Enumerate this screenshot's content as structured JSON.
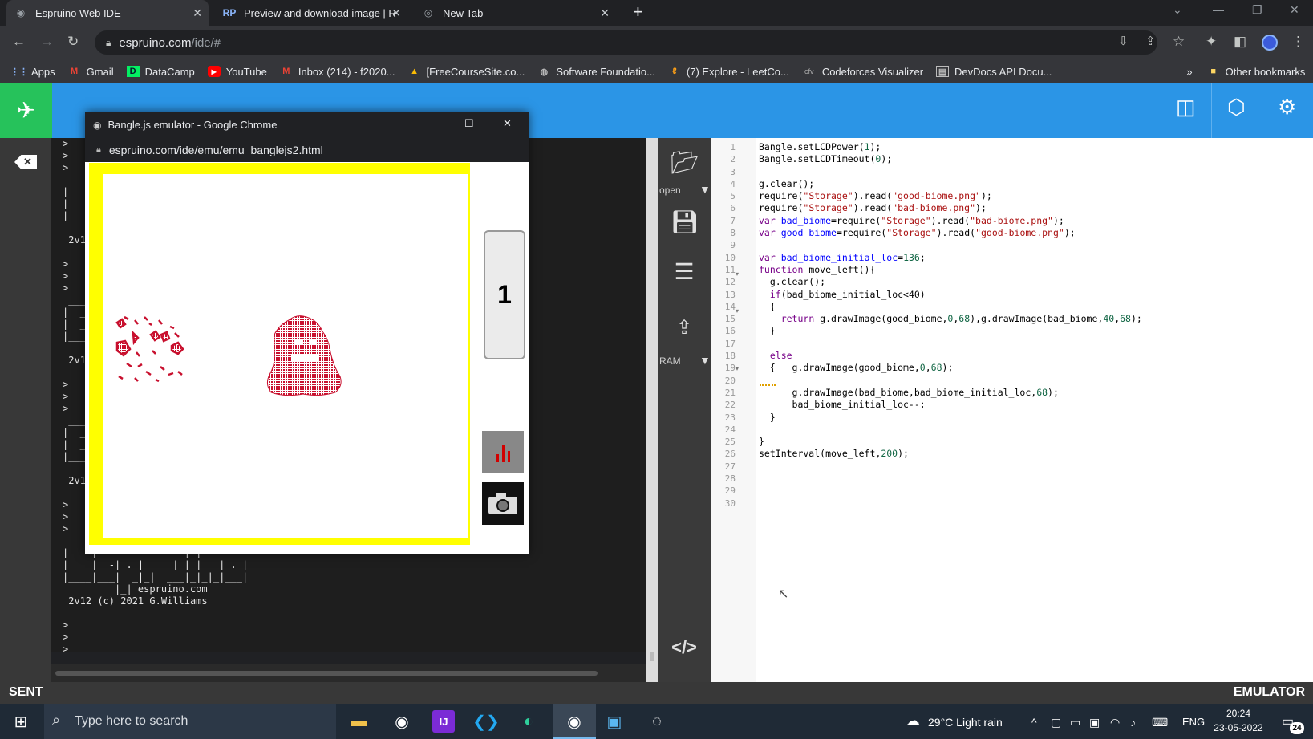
{
  "browser": {
    "tabs": [
      {
        "label": "Espruino Web IDE"
      },
      {
        "label": "Preview and download image | R"
      },
      {
        "label": "New Tab"
      }
    ],
    "url_host": "espruino.com",
    "url_path": "/ide/#",
    "bookmarks": [
      {
        "label": "Apps",
        "icon": "apps-grid-icon"
      },
      {
        "label": "Gmail",
        "icon": "gmail-icon"
      },
      {
        "label": "DataCamp",
        "icon": "datacamp-icon"
      },
      {
        "label": "YouTube",
        "icon": "youtube-icon"
      },
      {
        "label": "Inbox (214) - f2020...",
        "icon": "gmail-icon"
      },
      {
        "label": "[FreeCourseSite.co...",
        "icon": "drive-icon"
      },
      {
        "label": "Software Foundatio...",
        "icon": "globe-icon"
      },
      {
        "label": "(7) Explore - LeetCo...",
        "icon": "leetcode-icon"
      },
      {
        "label": "Codeforces Visualizer",
        "icon": "cfv-icon"
      },
      {
        "label": "DevDocs API Docu...",
        "icon": "devdocs-icon"
      }
    ],
    "more_bookmarks": "»",
    "other_bookmarks": "Other bookmarks"
  },
  "emulator": {
    "window_title": "Bangle.js emulator - Google Chrome",
    "url": "espruino.com/ide/emu/emu_banglejs2.html",
    "button_label": "1"
  },
  "terminal": {
    "lines": [
      ">",
      ">",
      ">",
      " ____                 _",
      "|  __|___ ___ ___ _ _|_|___ ___",
      "|  __|_ -| . |  _| | | |   | . |",
      "|____|___|  _|_| |___|_|_|_|___|",
      "         |_| espruino.com",
      " 2v1",
      "",
      ">",
      ">",
      ">",
      " ____",
      "|  __",
      "|  __",
      "|____",
      "",
      " 2v1",
      "",
      ">",
      ">",
      ">",
      " ____",
      "|  __",
      "|  __",
      "|____",
      "",
      " 2v1",
      "",
      ">",
      ">",
      ">",
      " ____                 _",
      "|  __|___ ___ ___ _ _|_|___ ___",
      "|  __|_ -| . |  _| | | |   | . |",
      "|____|___|  _|_| |___|_|_|_|___|",
      "         |_| espruino.com",
      " 2v12 (c) 2021 G.Williams",
      "",
      ">",
      ">",
      ">"
    ]
  },
  "sidebar": {
    "open_label": "open",
    "ram_label": "RAM"
  },
  "editor": {
    "line_count": 30,
    "lines": [
      "Bangle.setLCDPower(1);",
      "Bangle.setLCDTimeout(0);",
      "",
      "g.clear();",
      "require(\"Storage\").read(\"good-biome.png\");",
      "require(\"Storage\").read(\"bad-biome.png\");",
      "var bad_biome=require(\"Storage\").read(\"bad-biome.png\");",
      "var good_biome=require(\"Storage\").read(\"good-biome.png\");",
      "",
      "var bad_biome_initial_loc=136;",
      "function move_left(){",
      "  g.clear();",
      "  if(bad_biome_initial_loc<40)",
      "  {",
      "    return g.drawImage(good_biome,0,68),g.drawImage(bad_biome,40,68);",
      "  }",
      "",
      "  else",
      "  {   g.drawImage(good_biome,0,68);",
      "",
      "      g.drawImage(bad_biome,bad_biome_initial_loc,68);",
      "      bad_biome_initial_loc--;",
      "  }",
      "",
      "}",
      "setInterval(move_left,200);",
      "",
      "",
      "",
      ""
    ]
  },
  "status": {
    "left": "SENT",
    "right": "EMULATOR"
  },
  "taskbar": {
    "search_placeholder": "Type here to search",
    "weather": "29°C  Light rain",
    "lang": "ENG",
    "time": "20:24",
    "date": "23-05-2022",
    "notif_count": "24"
  },
  "colors": {
    "ide_header": "#2b95e6",
    "ide_logo": "#26c25b",
    "lcd_border": "#ffff00",
    "sprite": "#c8102e"
  }
}
